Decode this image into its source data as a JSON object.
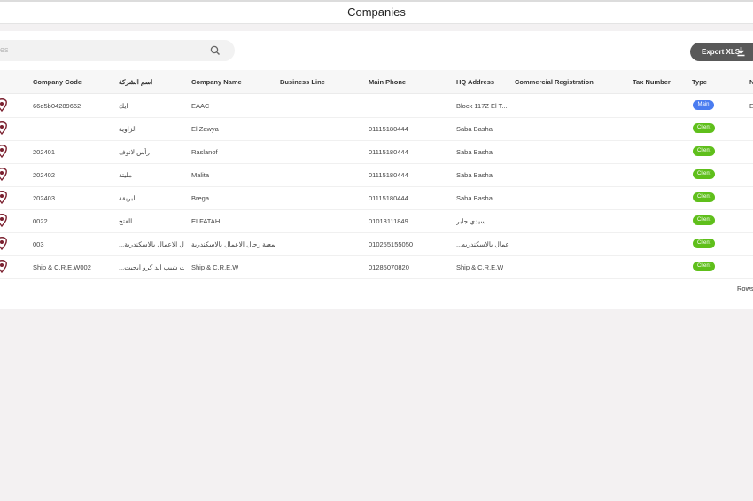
{
  "app": {
    "title": "Companies"
  },
  "search": {
    "placeholder": "es"
  },
  "toolbar": {
    "export_label": "Export XLS"
  },
  "colors": {
    "main_badge": "#4a7cf0",
    "client_badge": "#5fbf1b",
    "export_button": "#595959"
  },
  "table": {
    "columns": [
      "Company Code",
      "اسم الشركة",
      "Company Name",
      "Business Line",
      "Main Phone",
      "HQ Address",
      "Commercial Registration",
      "Tax Number",
      "Type",
      "N"
    ],
    "rows": [
      {
        "code": "66d5b04289662",
        "arabic": "ايك",
        "name": "EAAC",
        "phone": "",
        "address": "Block 117Z El T...",
        "type": "Main",
        "extra": "E"
      },
      {
        "code": "",
        "arabic": "الزاوية",
        "name": "El Zawya",
        "phone": "01115180444",
        "address": "Saba Basha",
        "type": "Client",
        "extra": ""
      },
      {
        "code": "202401",
        "arabic": "رأس لانوف",
        "name": "Raslanof",
        "phone": "01115180444",
        "address": "Saba Basha",
        "type": "Client",
        "extra": ""
      },
      {
        "code": "202402",
        "arabic": "مليتة",
        "name": "Malita",
        "phone": "01115180444",
        "address": "Saba Basha",
        "type": "Client",
        "extra": ""
      },
      {
        "code": "202403",
        "arabic": "البريقة",
        "name": "Brega",
        "phone": "01115180444",
        "address": "Saba Basha",
        "type": "Client",
        "extra": ""
      },
      {
        "code": "0022",
        "arabic": "الفتح",
        "name": "ELFATAH",
        "phone": "01013111849",
        "address": "سيدي جابر",
        "type": "Client",
        "extra": ""
      },
      {
        "code": "003",
        "arabic": "...ة رجال الاعمال بالاسكندرية",
        "name": "شركة جمعية رجال الاعمال بالاسكندرية",
        "phone": "010255155050",
        "address": "...ل الاعمال بالاسكندريه",
        "type": "Client",
        "extra": ""
      },
      {
        "code": "Ship & C.R.E.W002",
        "arabic": "...حاويات شيب اند كرو ايجبت",
        "name": "Ship & C.R.E.W",
        "phone": "01285070820",
        "address": "Ship & C.R.E.W",
        "type": "Client",
        "extra": ""
      }
    ]
  },
  "footer": {
    "rows_label": "Rows"
  }
}
